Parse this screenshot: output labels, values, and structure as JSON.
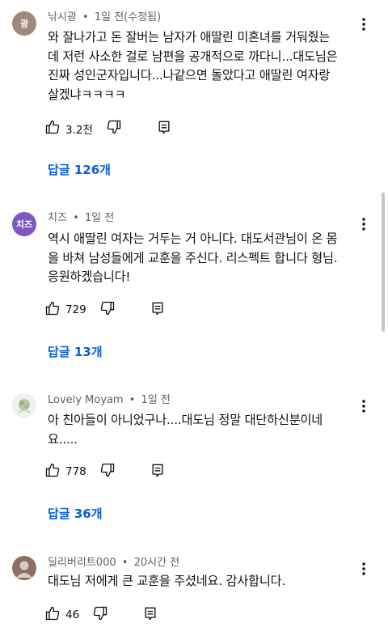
{
  "comments": [
    {
      "avatar_text": "광",
      "avatar_color": "#a1887f",
      "author": "낚시광",
      "time": "1일 전(수정됨)",
      "lines": [
        "와 잘나가고 돈 잘버는 남자가 애딸린 미혼녀를 거둬줬는",
        "데 저런 사소한 걸로 남편을 공개적으로 까다니...대도님은",
        "진짜 성인군자입니다...나같으면 돌았다고 애딸린 여자랑",
        "살겠냐ㅋㅋㅋㅋ"
      ],
      "likes": "3.2천",
      "replies": "답글 126개"
    },
    {
      "avatar_text": "치즈",
      "avatar_color": "#7e57c2",
      "author": "치즈",
      "time": "1일 전",
      "lines": [
        "역시 애딸린 여자는 거두는 거 아니다. 대도서관님이 온 몸",
        "을 바쳐 남성들에게 교훈을 주신다. 리스펙트 합니다 형님.",
        "응원하겠습니다!"
      ],
      "likes": "729",
      "replies": "답글 13개"
    },
    {
      "avatar_text": "",
      "avatar_color": "#cfd8c5",
      "author": "Lovely Moyam",
      "time": "1일 전",
      "lines": [
        "아 친아들이 아니었구나....대도님 정말 대단하신분이네",
        "요....."
      ],
      "likes": "778",
      "replies": "답글 36개"
    },
    {
      "avatar_text": "",
      "avatar_color": "#8d6e63",
      "author": "딜리버리트000",
      "time": "20시간 전",
      "lines": [
        "대도님 저에게 큰 교훈을 주셨네요. 감사합니다."
      ],
      "likes": "46",
      "replies": ""
    }
  ],
  "separator": "•"
}
